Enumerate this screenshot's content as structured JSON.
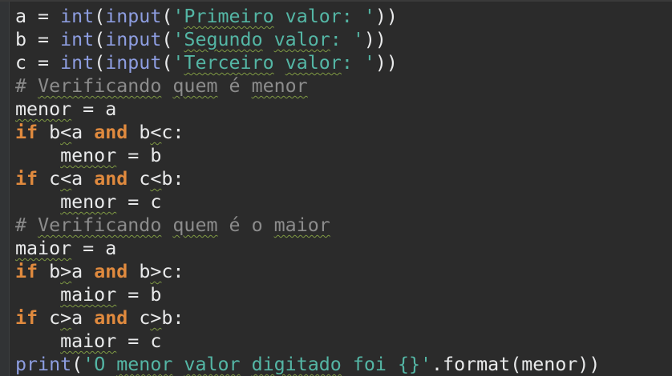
{
  "editor": {
    "lines": [
      [
        {
          "t": "a = "
        },
        {
          "t": "int",
          "c": "builtin"
        },
        {
          "t": "("
        },
        {
          "t": "input",
          "c": "builtin"
        },
        {
          "t": "("
        },
        {
          "t": "'",
          "c": "str"
        },
        {
          "t": "Primeiro",
          "c": "str sq"
        },
        {
          "t": " valor: '",
          "c": "str"
        },
        {
          "t": "))"
        }
      ],
      [
        {
          "t": "b = "
        },
        {
          "t": "int",
          "c": "builtin"
        },
        {
          "t": "("
        },
        {
          "t": "input",
          "c": "builtin"
        },
        {
          "t": "("
        },
        {
          "t": "'",
          "c": "str"
        },
        {
          "t": "Segundo",
          "c": "str sq"
        },
        {
          "t": " ",
          "c": "str"
        },
        {
          "t": "valor",
          "c": "str sq"
        },
        {
          "t": ": '",
          "c": "str"
        },
        {
          "t": "))"
        }
      ],
      [
        {
          "t": "c = "
        },
        {
          "t": "int",
          "c": "builtin"
        },
        {
          "t": "("
        },
        {
          "t": "input",
          "c": "builtin"
        },
        {
          "t": "("
        },
        {
          "t": "'",
          "c": "str"
        },
        {
          "t": "Terceiro",
          "c": "str sq"
        },
        {
          "t": " ",
          "c": "str"
        },
        {
          "t": "valor",
          "c": "str sq"
        },
        {
          "t": ": '",
          "c": "str"
        },
        {
          "t": "))"
        }
      ],
      [
        {
          "t": "# ",
          "c": "cm"
        },
        {
          "t": "Verificando",
          "c": "cm sq"
        },
        {
          "t": " ",
          "c": "cm"
        },
        {
          "t": "quem",
          "c": "cm sq"
        },
        {
          "t": " é ",
          "c": "cm"
        },
        {
          "t": "menor",
          "c": "cm sq"
        }
      ],
      [
        {
          "t": "menor",
          "c": "sq"
        },
        {
          "t": " = a"
        }
      ],
      [
        {
          "t": "if",
          "c": "kw"
        },
        {
          "t": " b"
        },
        {
          "t": "<",
          "c": "sq"
        },
        {
          "t": "a "
        },
        {
          "t": "and",
          "c": "kw"
        },
        {
          "t": " b"
        },
        {
          "t": "<",
          "c": "sq"
        },
        {
          "t": "c:"
        }
      ],
      [
        {
          "t": "    "
        },
        {
          "t": "menor",
          "c": "sq"
        },
        {
          "t": " = b"
        }
      ],
      [
        {
          "t": "if",
          "c": "kw"
        },
        {
          "t": " c"
        },
        {
          "t": "<",
          "c": "sq"
        },
        {
          "t": "a "
        },
        {
          "t": "and",
          "c": "kw"
        },
        {
          "t": " c"
        },
        {
          "t": "<",
          "c": "sq"
        },
        {
          "t": "b:"
        }
      ],
      [
        {
          "t": "    "
        },
        {
          "t": "menor",
          "c": "sq"
        },
        {
          "t": " = c"
        }
      ],
      [
        {
          "t": "# ",
          "c": "cm"
        },
        {
          "t": "Verificando",
          "c": "cm sq"
        },
        {
          "t": " ",
          "c": "cm"
        },
        {
          "t": "quem",
          "c": "cm sq"
        },
        {
          "t": " é o ",
          "c": "cm"
        },
        {
          "t": "maior",
          "c": "cm sq"
        }
      ],
      [
        {
          "t": "maior",
          "c": "sq"
        },
        {
          "t": " = a"
        }
      ],
      [
        {
          "t": "if",
          "c": "kw"
        },
        {
          "t": " b"
        },
        {
          "t": ">",
          "c": "sq"
        },
        {
          "t": "a "
        },
        {
          "t": "and",
          "c": "kw"
        },
        {
          "t": " b"
        },
        {
          "t": ">",
          "c": "sq"
        },
        {
          "t": "c:"
        }
      ],
      [
        {
          "t": "    "
        },
        {
          "t": "maior",
          "c": "sq"
        },
        {
          "t": " = b"
        }
      ],
      [
        {
          "t": "if",
          "c": "kw"
        },
        {
          "t": " c"
        },
        {
          "t": ">",
          "c": "sq"
        },
        {
          "t": "a "
        },
        {
          "t": "and",
          "c": "kw"
        },
        {
          "t": " c"
        },
        {
          "t": ">",
          "c": "sq"
        },
        {
          "t": "b:"
        }
      ],
      [
        {
          "t": "    "
        },
        {
          "t": "maior",
          "c": "sq"
        },
        {
          "t": " = c"
        }
      ],
      [
        {
          "t": "print",
          "c": "builtin"
        },
        {
          "t": "("
        },
        {
          "t": "'O ",
          "c": "str"
        },
        {
          "t": "menor",
          "c": "str sq"
        },
        {
          "t": " ",
          "c": "str"
        },
        {
          "t": "valor",
          "c": "str sq"
        },
        {
          "t": " ",
          "c": "str"
        },
        {
          "t": "digitado",
          "c": "str sq"
        },
        {
          "t": " foi {}'",
          "c": "str"
        },
        {
          "t": ".format(menor))"
        }
      ]
    ]
  }
}
